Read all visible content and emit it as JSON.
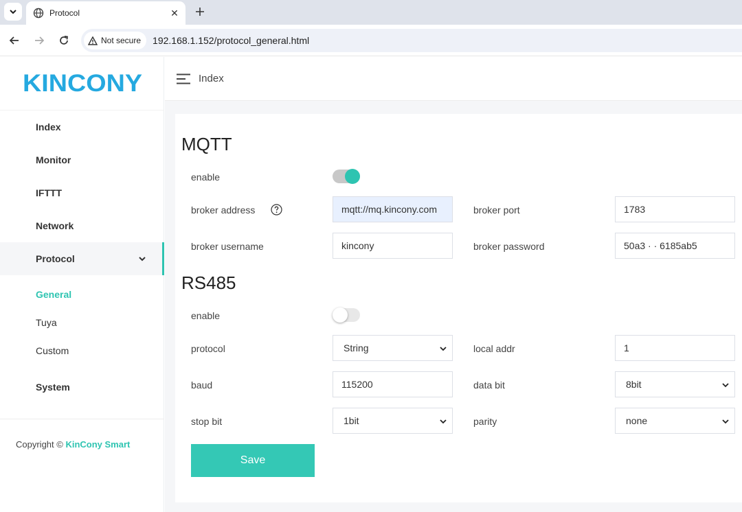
{
  "browser": {
    "tab_title": "Protocol",
    "security_label": "Not secure",
    "url": "192.168.1.152/protocol_general.html"
  },
  "brand": {
    "logo_text": "KINCONY",
    "accent_color": "#2ec4b1",
    "logo_color": "#25a9e0"
  },
  "sidebar": {
    "items": [
      {
        "label": "Index"
      },
      {
        "label": "Monitor"
      },
      {
        "label": "IFTTT"
      },
      {
        "label": "Network"
      },
      {
        "label": "Protocol"
      },
      {
        "label": "System"
      }
    ],
    "protocol_sub": [
      {
        "label": "General"
      },
      {
        "label": "Tuya"
      },
      {
        "label": "Custom"
      }
    ],
    "copyright_prefix": "Copyright ©",
    "copyright_link": "KinCony Smart"
  },
  "header": {
    "breadcrumb": "Index"
  },
  "mqtt": {
    "title": "MQTT",
    "enable_label": "enable",
    "enabled": true,
    "broker_address_label": "broker address",
    "broker_address": "mqtt://mq.kincony.com",
    "broker_port_label": "broker port",
    "broker_port": "1783",
    "broker_username_label": "broker username",
    "broker_username": "kincony",
    "broker_password_label": "broker password",
    "broker_password": "50a3  ·  ·  6185ab5"
  },
  "rs485": {
    "title": "RS485",
    "enable_label": "enable",
    "enabled": false,
    "protocol_label": "protocol",
    "protocol": "String",
    "local_addr_label": "local addr",
    "local_addr": "1",
    "baud_label": "baud",
    "baud": "115200",
    "data_bit_label": "data bit",
    "data_bit": "8bit",
    "stop_bit_label": "stop bit",
    "stop_bit": "1bit",
    "parity_label": "parity",
    "parity": "none"
  },
  "actions": {
    "save_label": "Save"
  }
}
